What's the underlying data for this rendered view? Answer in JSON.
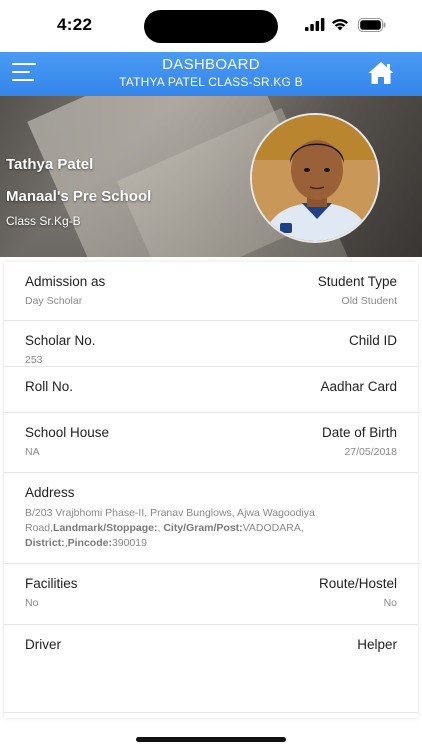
{
  "status_bar": {
    "time": "4:22"
  },
  "header": {
    "title": "DASHBOARD",
    "subtitle": "TATHYA PATEL CLASS-SR.KG B",
    "menu_icon": "hamburger-menu-icon",
    "home_icon": "home-icon",
    "color": "#3d90ee"
  },
  "profile": {
    "name": "Tathya Patel",
    "school": "Manaal's Pre School",
    "class": "Class Sr.Kg-B"
  },
  "details": {
    "admission": {
      "label": "Admission as",
      "value": "Day Scholar"
    },
    "student_type": {
      "label": "Student Type",
      "value": "Old Student"
    },
    "scholar_no": {
      "label": "Scholar No.",
      "value": "253"
    },
    "child_id": {
      "label": "Child ID",
      "value": ""
    },
    "roll_no": {
      "label": "Roll No.",
      "value": ""
    },
    "aadhar": {
      "label": "Aadhar Card",
      "value": ""
    },
    "house": {
      "label": "School House",
      "value": "NA"
    },
    "dob": {
      "label": "Date of Birth",
      "value": "27/05/2018"
    },
    "address": {
      "label": "Address",
      "line": "B/203 Vrajbhomi Phase-II, Pranav Bunglows, Ajwa Wagoodiya Road,",
      "landmark_label": "Landmark/Stoppage:",
      "landmark_value": ",",
      "city_label": "City/Gram/Post:",
      "city_value": "VADODARA,",
      "district_label": "District:",
      "district_value": ",",
      "pincode_label": "Pincode:",
      "pincode_value": "390019"
    },
    "facilities": {
      "label": "Facilities",
      "value": "No"
    },
    "route": {
      "label": "Route/Hostel",
      "value": "No"
    },
    "driver": {
      "label": "Driver",
      "value": ""
    },
    "helper": {
      "label": "Helper",
      "value": ""
    }
  }
}
